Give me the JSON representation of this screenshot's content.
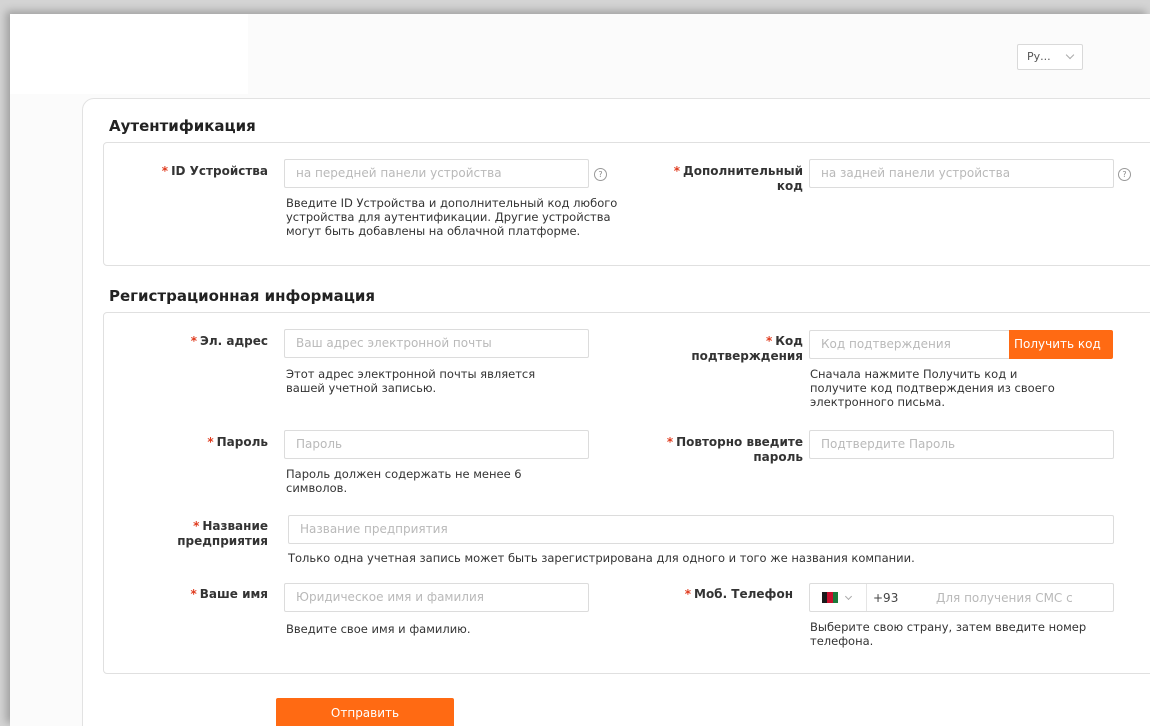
{
  "language": {
    "selected": "Ру..."
  },
  "auth": {
    "title": "Аутентификация",
    "device_id": {
      "label": "ID Устройства",
      "placeholder": "на передней панели устройства"
    },
    "extra_code": {
      "label_line1": "Дополнительный",
      "label_line2": "код",
      "placeholder": "на задней панели устройства"
    },
    "hint_lines": [
      "Введите ID Устройства и дополнительный код любого",
      "устройства для аутентификации. Другие устройства",
      "могут быть добавлены на облачной платформе."
    ]
  },
  "reg": {
    "title": "Регистрационная информация",
    "email": {
      "label": "Эл. адрес",
      "placeholder": "Ваш адрес электронной почты",
      "hint_lines": [
        "Этот адрес электронной почты является",
        "вашей учетной записью."
      ]
    },
    "code": {
      "label_line1": "Код",
      "label_line2": "подтверждения",
      "placeholder": "Код подтверждения",
      "button": "Получить код",
      "hint_lines": [
        "Сначала нажмите Получить код и",
        "получите код подтверждения из своего",
        "электронного письма."
      ]
    },
    "password": {
      "label": "Пароль",
      "placeholder": "Пароль",
      "hint_lines": [
        "Пароль должен содержать не менее 6",
        "символов."
      ]
    },
    "password_repeat": {
      "label_line1": "Повторно введите",
      "label_line2": "пароль",
      "placeholder": "Подтвердите Пароль"
    },
    "company": {
      "label_line1": "Название",
      "label_line2": "предприятия",
      "placeholder": "Название предприятия",
      "hint": "Только одна учетная запись может быть зарегистрирована для одного и того же названия компании."
    },
    "name": {
      "label": "Ваше имя",
      "placeholder": "Юридическое имя и фамилия",
      "hint": "Введите свое имя и фамилию."
    },
    "phone": {
      "label": "Моб. Телефон",
      "prefix": "+93",
      "placeholder": "Для получения СМС с",
      "hint_lines": [
        "Выберите свою страну, затем введите номер",
        "телефона."
      ]
    }
  },
  "submit": {
    "label": "Отправить"
  },
  "colors": {
    "accent": "#ff6a13",
    "required": "#e03c1f"
  },
  "icons": {
    "help": "question-circle-icon",
    "flag": "afghanistan-flag-icon",
    "caret": "chevron-down-icon"
  }
}
